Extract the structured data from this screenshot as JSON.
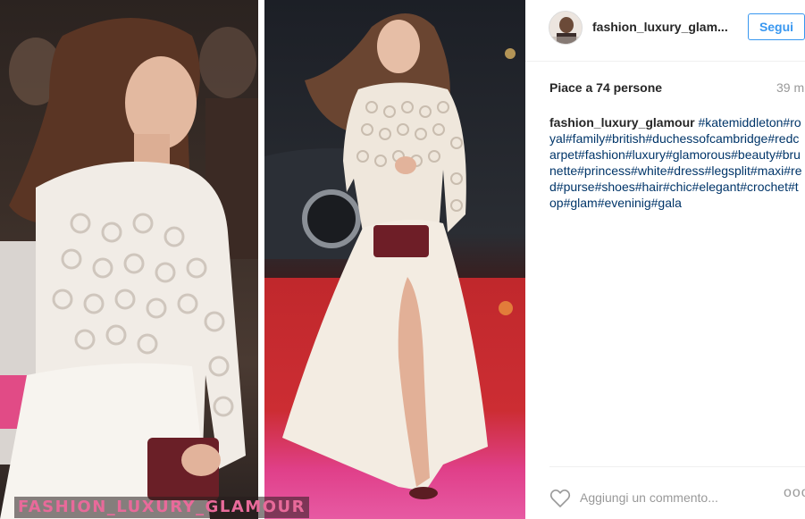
{
  "watermark": {
    "text": "FASHION_LUXURY_GLAMOUR",
    "color": "#e86a9a"
  },
  "header": {
    "username": "fashion_luxury_glam...",
    "follow_label": "Segui"
  },
  "post": {
    "likes_text": "Piace a 74 persone",
    "time_text": "39 m",
    "caption_user": "fashion_luxury_glamour",
    "caption_tags": "#katemiddleton#royal#family#british#duchessofcambridge#redcarpet#fashion#luxury#glamorous#beauty#brunette#princess#white#dress#legsplit#maxi#red#purse#shoes#hair#chic#elegant#crochet#top#glam#eveninig#gala"
  },
  "comment": {
    "placeholder": "Aggiungi un commento...",
    "more_label": "ooo"
  },
  "icons": {
    "heart": "heart-icon",
    "more": "more-options-icon"
  },
  "colors": {
    "accent": "#3897f0",
    "hashtag": "#003569",
    "muted": "#999999"
  }
}
